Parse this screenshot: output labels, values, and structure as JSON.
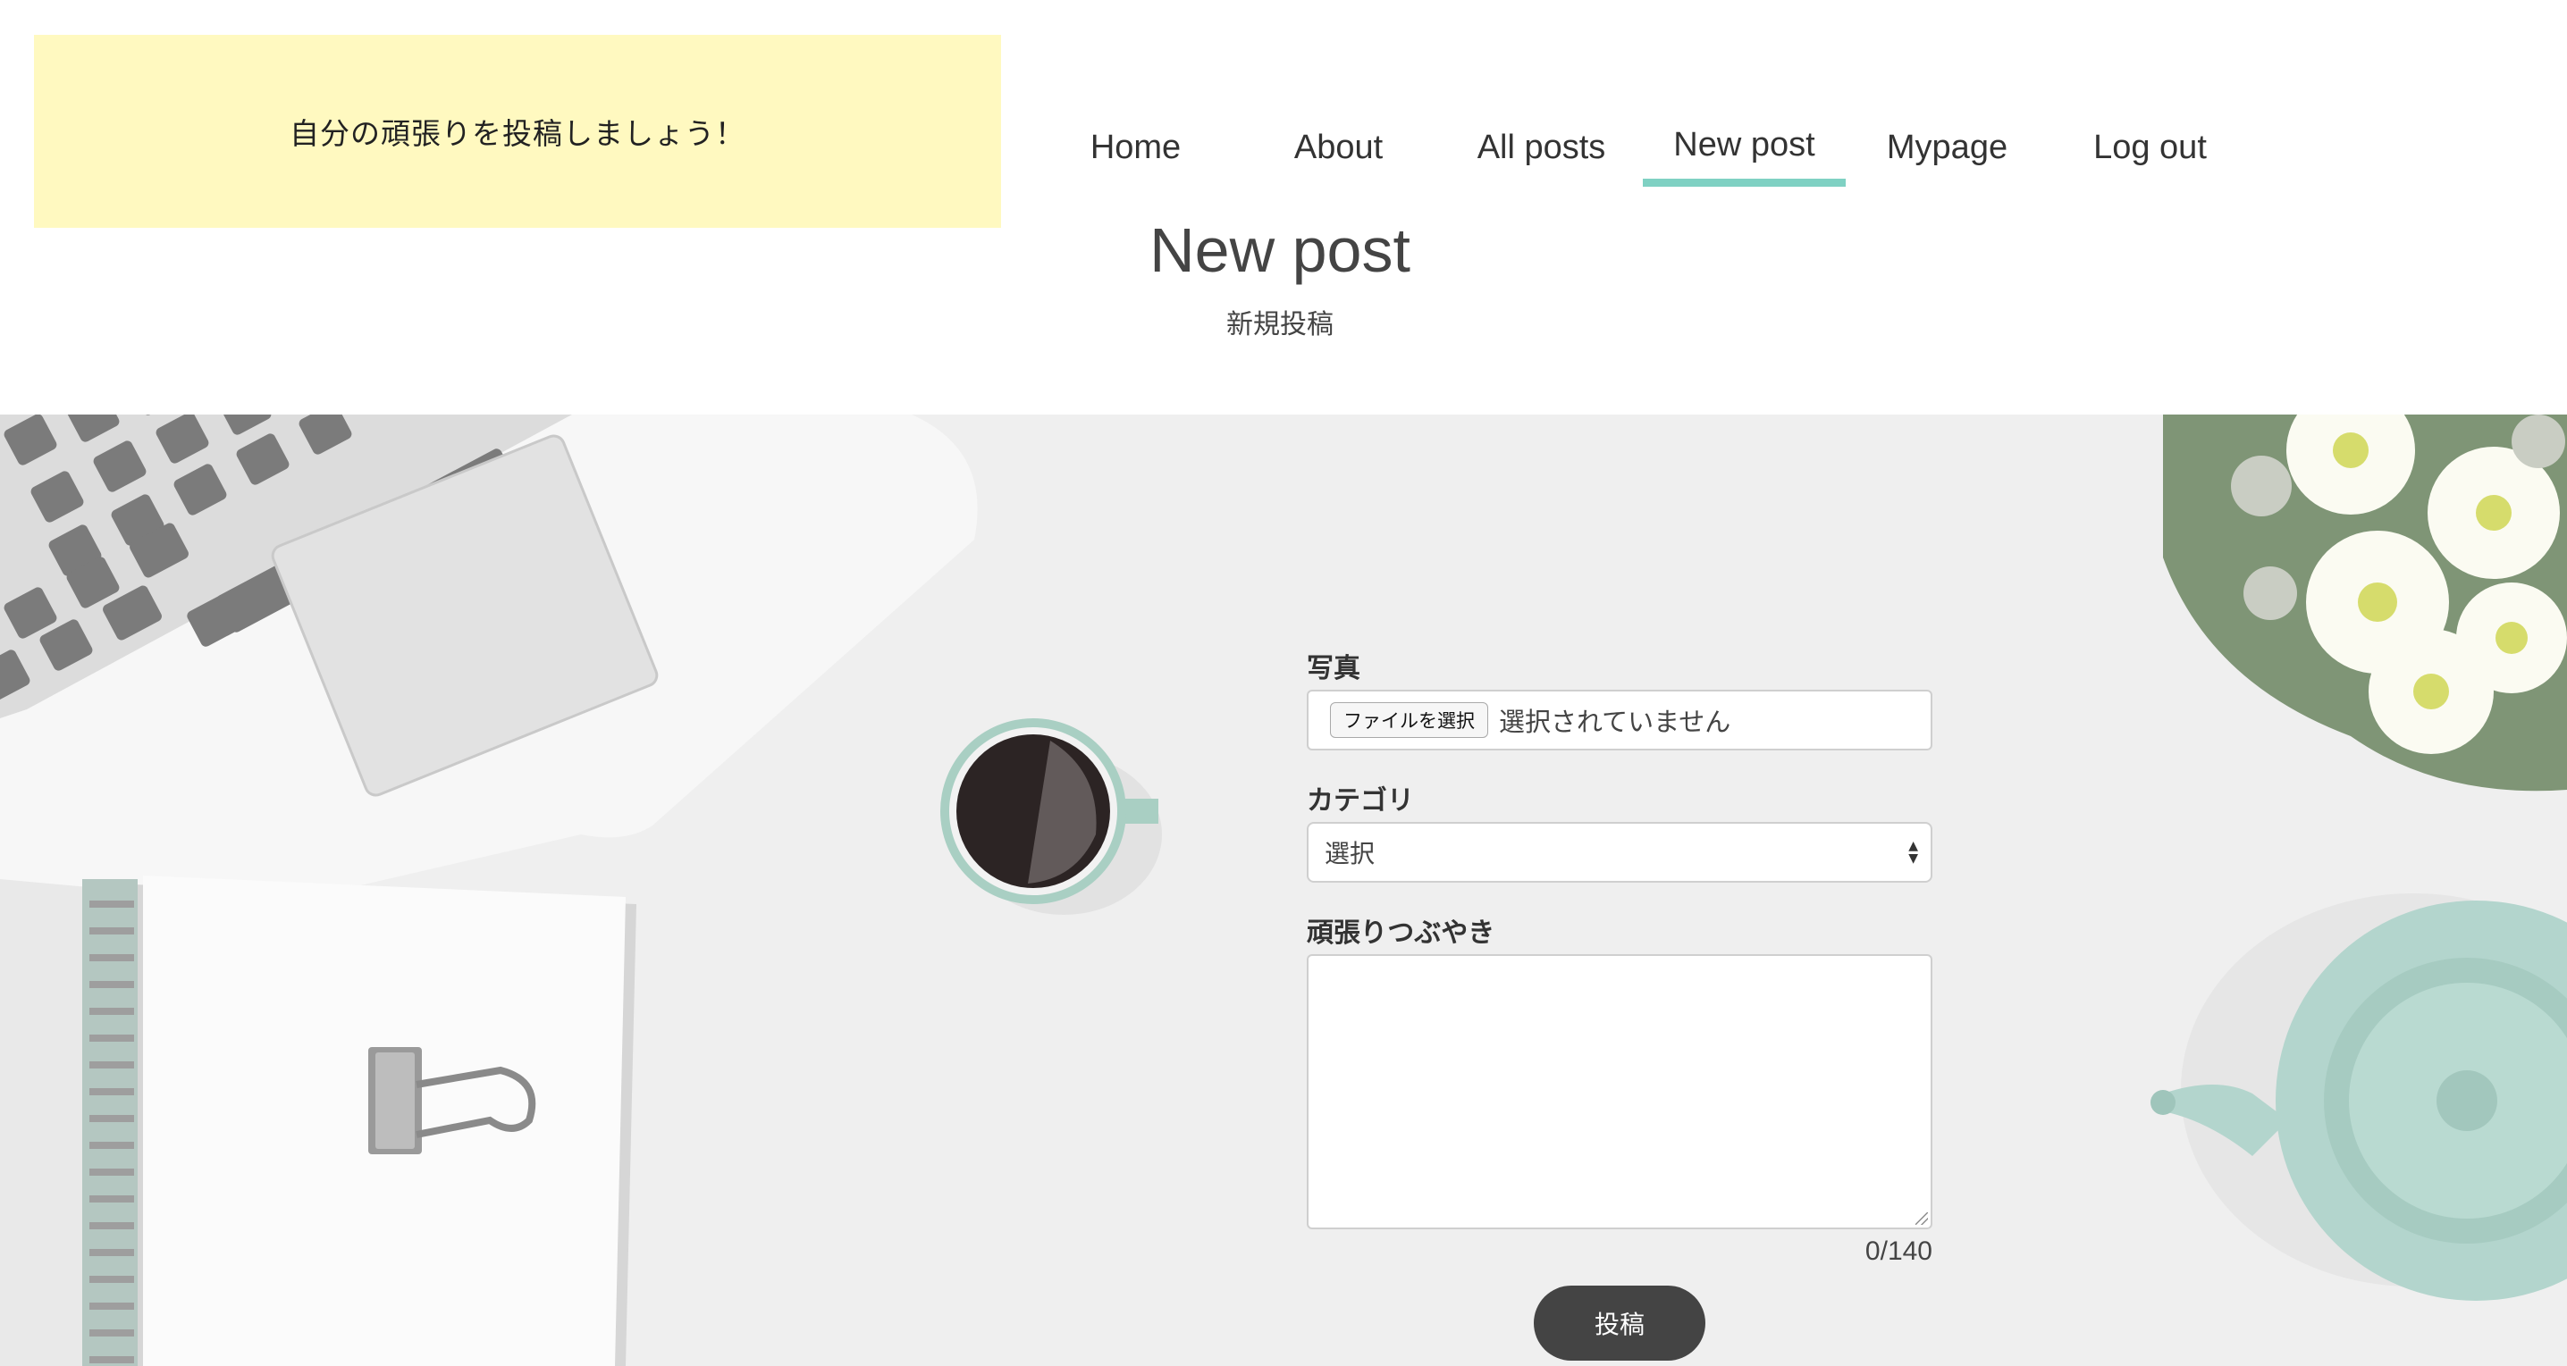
{
  "header": {
    "banner_text": "自分の頑張りを投稿しましょう！",
    "nav": [
      {
        "label": "Home"
      },
      {
        "label": "About"
      },
      {
        "label": "All posts"
      },
      {
        "label": "New post",
        "active": true
      },
      {
        "label": "Mypage"
      },
      {
        "label": "Log out"
      }
    ],
    "accent_color": "#7fd1c3",
    "banner_color": "#fff9c0"
  },
  "page": {
    "title": "New post",
    "subtitle": "新規投稿"
  },
  "form": {
    "photo": {
      "label": "写真",
      "button_label": "ファイルを選択",
      "status": "選択されていません"
    },
    "category": {
      "label": "カテゴリ",
      "selected": "選択"
    },
    "message": {
      "label": "頑張りつぶやき",
      "value": "",
      "counter": "0/140"
    },
    "submit_label": "投稿",
    "submit_color": "#444444"
  },
  "background": {
    "description_icons": [
      "laptop-illustration",
      "coffee-cup-illustration",
      "notebook-illustration",
      "binder-clip-illustration",
      "flowers-illustration",
      "teapot-illustration"
    ]
  }
}
